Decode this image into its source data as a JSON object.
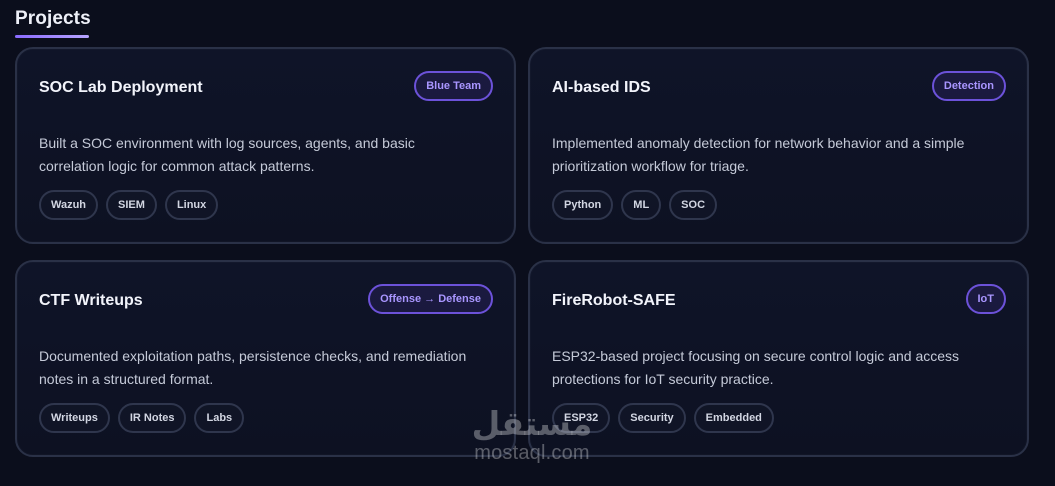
{
  "section": {
    "title": "Projects"
  },
  "projects": [
    {
      "title": "SOC Lab Deployment",
      "badge": "Blue Team",
      "description": "Built a SOC environment with log sources, agents, and basic correlation logic for common attack patterns.",
      "tags": [
        "Wazuh",
        "SIEM",
        "Linux"
      ]
    },
    {
      "title": "AI-based IDS",
      "badge": "Detection",
      "description": "Implemented anomaly detection for network behavior and a simple prioritization workflow for triage.",
      "tags": [
        "Python",
        "ML",
        "SOC"
      ]
    },
    {
      "title": "CTF Writeups",
      "badge": "Offense → Defense",
      "description": "Documented exploitation paths, persistence checks, and remediation notes in a structured format.",
      "tags": [
        "Writeups",
        "IR Notes",
        "Labs"
      ]
    },
    {
      "title": "FireRobot-SAFE",
      "badge": "IoT",
      "description": "ESP32-based project focusing on secure control logic and access protections for IoT security practice.",
      "tags": [
        "ESP32",
        "Security",
        "Embedded"
      ]
    }
  ],
  "watermark": {
    "logo_text": "مستقل",
    "site_text": "mostaql.com"
  },
  "colors": {
    "accent": "#8a6bff",
    "background": "#0b0e1c",
    "card_border": "#2a3147"
  }
}
